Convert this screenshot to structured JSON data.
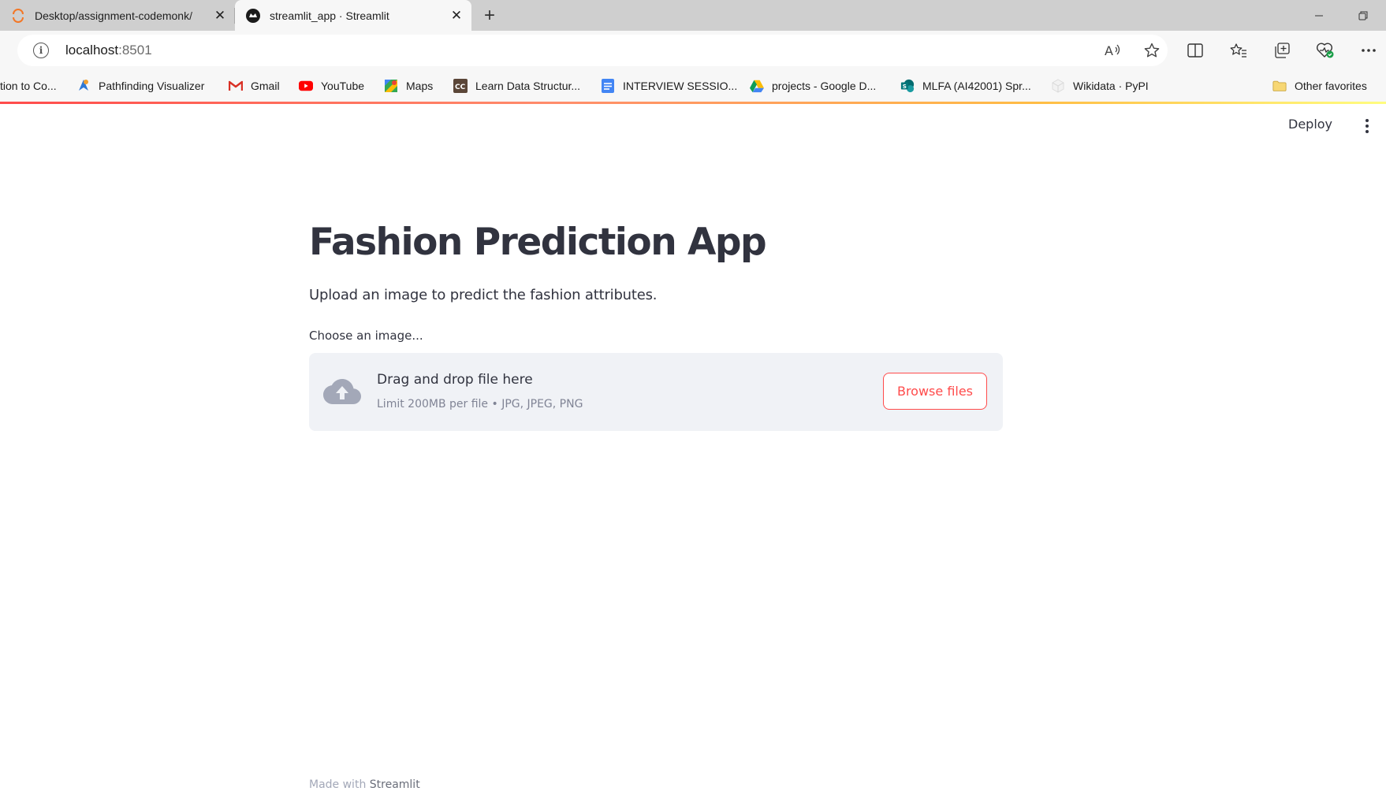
{
  "browser": {
    "tabs": [
      {
        "title": "Desktop/assignment-codemonk/",
        "active": false
      },
      {
        "title": "streamlit_app · Streamlit",
        "active": true
      }
    ],
    "address": {
      "host": "localhost",
      "port": ":8501"
    },
    "favorites": [
      {
        "label": "tion to Co...",
        "icon": "none"
      },
      {
        "label": "Pathfinding Visualizer",
        "icon": "pathfinding-icon"
      },
      {
        "label": "Gmail",
        "icon": "gmail-icon"
      },
      {
        "label": "YouTube",
        "icon": "youtube-icon"
      },
      {
        "label": "Maps",
        "icon": "maps-icon"
      },
      {
        "label": "Learn Data Structur...",
        "icon": "codechef-icon"
      },
      {
        "label": "INTERVIEW SESSIO...",
        "icon": "google-docs-icon"
      },
      {
        "label": "projects - Google D...",
        "icon": "google-drive-icon"
      },
      {
        "label": "MLFA (AI42001) Spr...",
        "icon": "sharepoint-icon"
      },
      {
        "label": "Wikidata · PyPI",
        "icon": "pypi-icon"
      }
    ],
    "other_favorites": "Other favorites"
  },
  "header": {
    "deploy_label": "Deploy"
  },
  "app": {
    "title": "Fashion Prediction App",
    "subtitle": "Upload an image to predict the fashion attributes.",
    "uploader": {
      "label": "Choose an image...",
      "drop_text": "Drag and drop file here",
      "limit_text": "Limit 200MB per file • JPG, JPEG, PNG",
      "browse_label": "Browse files"
    }
  },
  "footer": {
    "prefix": "Made with",
    "brand": "Streamlit"
  },
  "colors": {
    "accent": "#ff4b4b",
    "text": "#31333f",
    "dropzone_bg": "#f0f2f6",
    "muted": "#808495"
  }
}
